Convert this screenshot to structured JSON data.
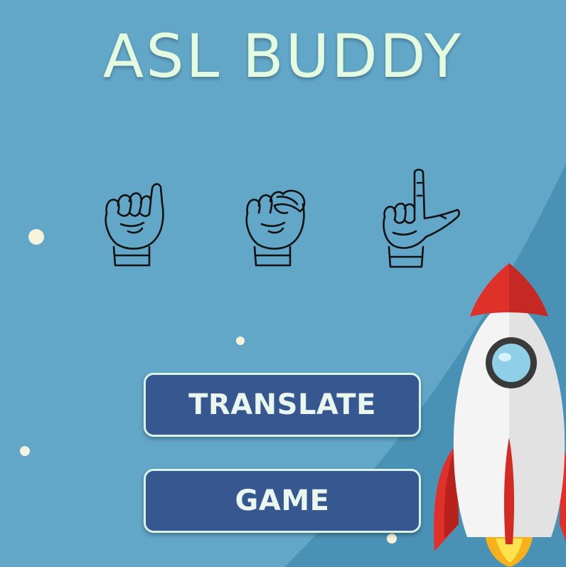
{
  "app": {
    "title": "ASL BUDDY"
  },
  "hands": [
    {
      "name": "hand-sign-a-icon",
      "letter": "A"
    },
    {
      "name": "hand-sign-s-icon",
      "letter": "S"
    },
    {
      "name": "hand-sign-l-icon",
      "letter": "L"
    }
  ],
  "buttons": {
    "translate_label": "TRANSLATE",
    "game_label": "GAME"
  },
  "colors": {
    "background": "#62a6c8",
    "planet_curve": "#4a92b5",
    "title": "#e4fbe0",
    "button_fill": "#36578f",
    "button_border": "#d9f4e2",
    "rocket_red": "#e0302a",
    "rocket_body": "#f4f4f4"
  },
  "decorations": [
    "star-dot",
    "rocket-illustration"
  ]
}
